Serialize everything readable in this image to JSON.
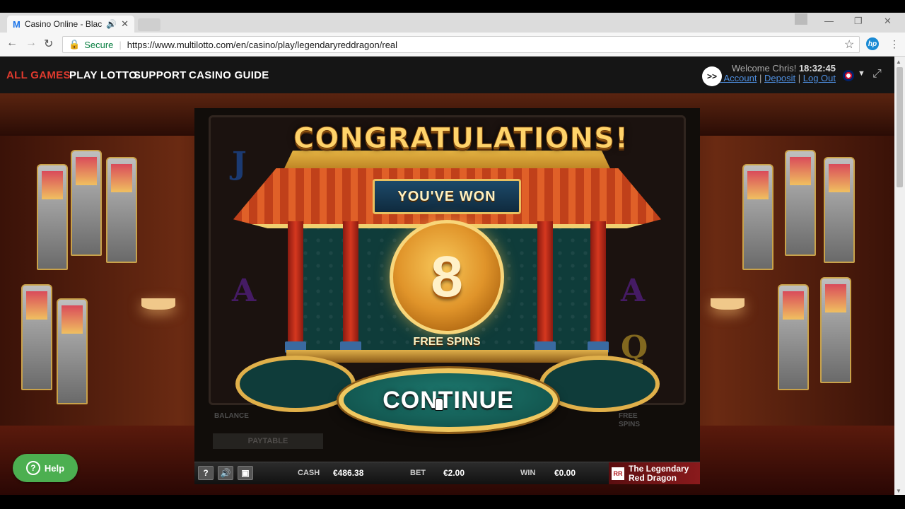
{
  "browser": {
    "tab_title": "Casino Online - Black",
    "tab_logo": "M",
    "omnibox_secure": "Secure",
    "url": "https://www.multilotto.com/en/casino/play/legendaryreddragon/real",
    "hp_label": "hp"
  },
  "site": {
    "menu": [
      "ALL GAMES",
      "PLAY LOTTO",
      "SUPPORT",
      "CASINO GUIDE"
    ],
    "welcome": "Welcome Chris!",
    "time": "18:32:45",
    "account_links": [
      "My Account",
      "Deposit",
      "Log Out"
    ],
    "help_label": "Help",
    "fast_forward": ">>"
  },
  "game": {
    "congrats": "CONGRATULATIONS!",
    "youve_won": "YOU'VE WON",
    "free_spins_count": "8",
    "free_spins_label": "FREE SPINS",
    "continue_label": "CONTINUE",
    "meter_balance": "BALANCE",
    "meter_free_spins": "FREE SPINS",
    "paytable": "PAYTABLE",
    "controls": {
      "help": "?",
      "cash_label": "CASH",
      "cash_value": "€486.38",
      "bet_label": "BET",
      "bet_value": "€2.00",
      "win_label": "WIN",
      "win_value": "€0.00",
      "brand_logo": "RR",
      "brand_line1": "The Legendary",
      "brand_line2": "Red Dragon"
    }
  },
  "colors": {
    "active_menu": "#e03a2e",
    "link": "#4f8fe0",
    "help_button": "#4caf50"
  }
}
